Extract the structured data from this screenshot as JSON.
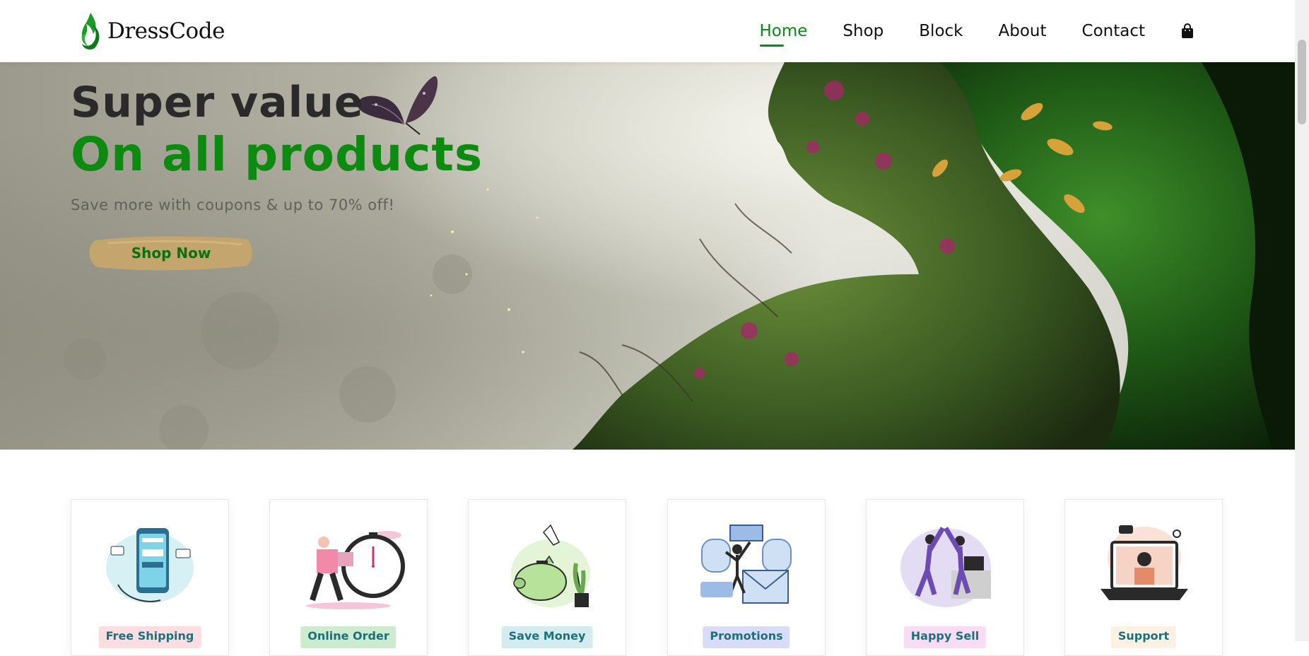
{
  "brand": {
    "name": "DressCode",
    "accent": "#0a8a16"
  },
  "nav": {
    "items": [
      {
        "label": "Home",
        "active": true
      },
      {
        "label": "Shop",
        "active": false
      },
      {
        "label": "Block",
        "active": false
      },
      {
        "label": "About",
        "active": false
      },
      {
        "label": "Contact",
        "active": false
      }
    ],
    "cart_icon": "shopping-bag-icon"
  },
  "hero": {
    "title_line1": "Super value",
    "title_line2": "On all products",
    "subtitle": "Save more with coupons & up to 70% off!",
    "button_label": "Shop Now",
    "title_color": "#0d8a10",
    "button_color": "#c9a66b"
  },
  "features": [
    {
      "label": "Free Shipping",
      "illustration": "phone-payment-illustration",
      "badge_bg": "#fbdde2",
      "badge_fg": "#1f6f7a"
    },
    {
      "label": "Online Order",
      "illustration": "delivery-clock-illustration",
      "badge_bg": "#cdeccf",
      "badge_fg": "#1f6f7a"
    },
    {
      "label": "Save Money",
      "illustration": "piggy-bank-illustration",
      "badge_bg": "#d4ecef",
      "badge_fg": "#1f6f7a"
    },
    {
      "label": "Promotions",
      "illustration": "promotions-illustration",
      "badge_bg": "#d9dcf7",
      "badge_fg": "#1f6f7a"
    },
    {
      "label": "Happy Sell",
      "illustration": "high-five-illustration",
      "badge_bg": "#f7dcf3",
      "badge_fg": "#1f6f7a"
    },
    {
      "label": "Support",
      "illustration": "support-laptop-illustration",
      "badge_bg": "#fdf1e3",
      "badge_fg": "#1f6f7a"
    }
  ]
}
